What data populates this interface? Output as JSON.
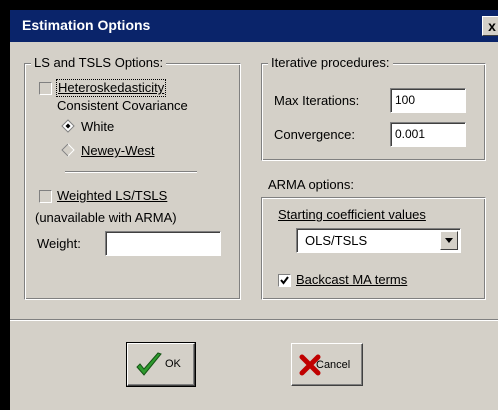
{
  "window": {
    "title": "Estimation Options",
    "close_label": "x"
  },
  "ls_group": {
    "label": "LS and TSLS Options:",
    "hetero_label": "Heteroskedasticity",
    "hetero_sub": "Consistent Covariance",
    "hetero_checked": false,
    "radio_white": "White",
    "radio_newey": "Newey-West",
    "selected_radio": "White",
    "weighted_label": "Weighted LS/TSLS",
    "weighted_note": "(unavailable with ARMA)",
    "weighted_checked": false,
    "weight_label": "Weight:",
    "weight_value": ""
  },
  "iter_group": {
    "label": "Iterative procedures:",
    "max_iter_label": "Max Iterations:",
    "max_iter_value": "100",
    "convergence_label": "Convergence:",
    "convergence_value": "0.001"
  },
  "arma_group": {
    "label": "ARMA options:",
    "starting_label": "Starting coefficient values",
    "starting_value": "OLS/TSLS",
    "backcast_label": "Backcast MA terms",
    "backcast_checked": true
  },
  "buttons": {
    "ok_label": "OK",
    "cancel_label": "Cancel"
  },
  "colors": {
    "titlebar": "#0a246a",
    "face": "#d4d0c8",
    "ok_check": "#2e9a2e",
    "cancel_x": "#c00000"
  }
}
